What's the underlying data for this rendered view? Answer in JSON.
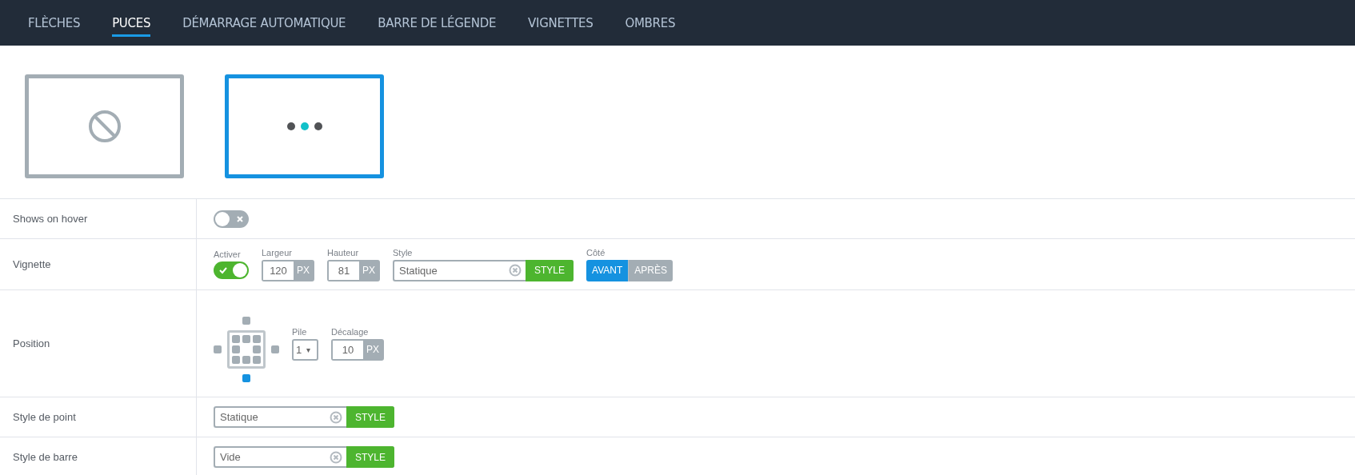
{
  "tabs": [
    {
      "label": "FLÈCHES",
      "selected": false
    },
    {
      "label": "PUCES",
      "selected": true
    },
    {
      "label": "DÉMARRAGE AUTOMATIQUE",
      "selected": false
    },
    {
      "label": "BARRE DE LÉGENDE",
      "selected": false
    },
    {
      "label": "VIGNETTES",
      "selected": false
    },
    {
      "label": "OMBRES",
      "selected": false
    }
  ],
  "thumbnails": [
    {
      "kind": "none",
      "selected": false
    },
    {
      "kind": "dots",
      "selected": true
    }
  ],
  "rows": [
    {
      "label": "Shows on hover",
      "fields": [
        {
          "kind": "toggle",
          "on": false
        }
      ]
    },
    {
      "label": "Vignette",
      "fields": [
        {
          "kind": "toggle",
          "label": "Activer",
          "on": true
        },
        {
          "kind": "unit",
          "label": "Largeur",
          "value": "120",
          "unit": "PX"
        },
        {
          "kind": "unit",
          "label": "Hauteur",
          "value": "81",
          "unit": "PX"
        },
        {
          "kind": "style",
          "label": "Style",
          "value": "Statique",
          "button": "STYLE"
        },
        {
          "kind": "segmented",
          "label": "Côté",
          "options": [
            {
              "label": "AVANT",
              "selected": true
            },
            {
              "label": "APRÈS",
              "selected": false
            }
          ]
        }
      ]
    },
    {
      "label": "Position",
      "fields": [
        {
          "kind": "grid",
          "outer": [
            {
              "selected": false
            },
            {
              "selected": false
            },
            {
              "selected": false
            },
            {
              "selected": true
            }
          ],
          "inner": [
            {
              "kind": "cell",
              "selected": false
            },
            {
              "kind": "cell",
              "selected": false
            },
            {
              "kind": "cell",
              "selected": false
            },
            {
              "kind": "cell",
              "selected": false
            },
            {
              "kind": "gap"
            },
            {
              "kind": "cell",
              "selected": false
            },
            {
              "kind": "cell",
              "selected": false
            },
            {
              "kind": "cell",
              "selected": false
            },
            {
              "kind": "cell",
              "selected": false
            }
          ]
        },
        {
          "kind": "select",
          "label": "Pile",
          "value": "1",
          "caret": "▾"
        },
        {
          "kind": "unit",
          "label": "Décalage",
          "value": "10",
          "unit": "PX"
        }
      ]
    },
    {
      "label": "Style de point",
      "fields": [
        {
          "kind": "style",
          "value": "Statique",
          "button": "STYLE"
        }
      ]
    },
    {
      "label": "Style de barre",
      "fields": [
        {
          "kind": "style",
          "value": "Vide",
          "button": "STYLE"
        }
      ]
    }
  ]
}
